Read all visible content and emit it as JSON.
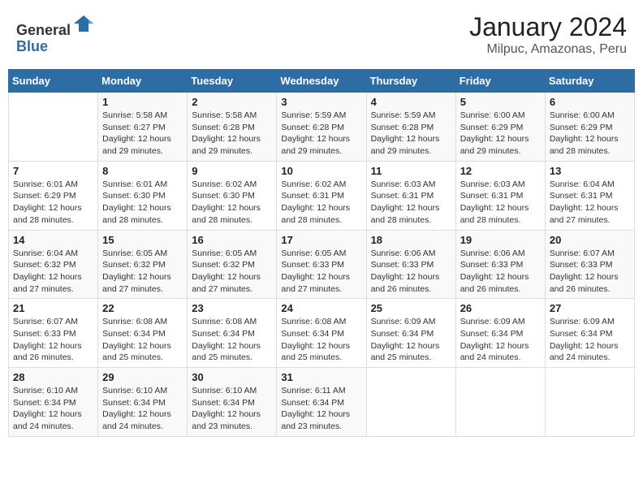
{
  "header": {
    "logo_general": "General",
    "logo_blue": "Blue",
    "title": "January 2024",
    "subtitle": "Milpuc, Amazonas, Peru"
  },
  "calendar": {
    "days_of_week": [
      "Sunday",
      "Monday",
      "Tuesday",
      "Wednesday",
      "Thursday",
      "Friday",
      "Saturday"
    ],
    "weeks": [
      [
        {
          "day": "",
          "info": ""
        },
        {
          "day": "1",
          "info": "Sunrise: 5:58 AM\nSunset: 6:27 PM\nDaylight: 12 hours\nand 29 minutes."
        },
        {
          "day": "2",
          "info": "Sunrise: 5:58 AM\nSunset: 6:28 PM\nDaylight: 12 hours\nand 29 minutes."
        },
        {
          "day": "3",
          "info": "Sunrise: 5:59 AM\nSunset: 6:28 PM\nDaylight: 12 hours\nand 29 minutes."
        },
        {
          "day": "4",
          "info": "Sunrise: 5:59 AM\nSunset: 6:28 PM\nDaylight: 12 hours\nand 29 minutes."
        },
        {
          "day": "5",
          "info": "Sunrise: 6:00 AM\nSunset: 6:29 PM\nDaylight: 12 hours\nand 29 minutes."
        },
        {
          "day": "6",
          "info": "Sunrise: 6:00 AM\nSunset: 6:29 PM\nDaylight: 12 hours\nand 28 minutes."
        }
      ],
      [
        {
          "day": "7",
          "info": "Sunrise: 6:01 AM\nSunset: 6:29 PM\nDaylight: 12 hours\nand 28 minutes."
        },
        {
          "day": "8",
          "info": "Sunrise: 6:01 AM\nSunset: 6:30 PM\nDaylight: 12 hours\nand 28 minutes."
        },
        {
          "day": "9",
          "info": "Sunrise: 6:02 AM\nSunset: 6:30 PM\nDaylight: 12 hours\nand 28 minutes."
        },
        {
          "day": "10",
          "info": "Sunrise: 6:02 AM\nSunset: 6:31 PM\nDaylight: 12 hours\nand 28 minutes."
        },
        {
          "day": "11",
          "info": "Sunrise: 6:03 AM\nSunset: 6:31 PM\nDaylight: 12 hours\nand 28 minutes."
        },
        {
          "day": "12",
          "info": "Sunrise: 6:03 AM\nSunset: 6:31 PM\nDaylight: 12 hours\nand 28 minutes."
        },
        {
          "day": "13",
          "info": "Sunrise: 6:04 AM\nSunset: 6:31 PM\nDaylight: 12 hours\nand 27 minutes."
        }
      ],
      [
        {
          "day": "14",
          "info": "Sunrise: 6:04 AM\nSunset: 6:32 PM\nDaylight: 12 hours\nand 27 minutes."
        },
        {
          "day": "15",
          "info": "Sunrise: 6:05 AM\nSunset: 6:32 PM\nDaylight: 12 hours\nand 27 minutes."
        },
        {
          "day": "16",
          "info": "Sunrise: 6:05 AM\nSunset: 6:32 PM\nDaylight: 12 hours\nand 27 minutes."
        },
        {
          "day": "17",
          "info": "Sunrise: 6:05 AM\nSunset: 6:33 PM\nDaylight: 12 hours\nand 27 minutes."
        },
        {
          "day": "18",
          "info": "Sunrise: 6:06 AM\nSunset: 6:33 PM\nDaylight: 12 hours\nand 26 minutes."
        },
        {
          "day": "19",
          "info": "Sunrise: 6:06 AM\nSunset: 6:33 PM\nDaylight: 12 hours\nand 26 minutes."
        },
        {
          "day": "20",
          "info": "Sunrise: 6:07 AM\nSunset: 6:33 PM\nDaylight: 12 hours\nand 26 minutes."
        }
      ],
      [
        {
          "day": "21",
          "info": "Sunrise: 6:07 AM\nSunset: 6:33 PM\nDaylight: 12 hours\nand 26 minutes."
        },
        {
          "day": "22",
          "info": "Sunrise: 6:08 AM\nSunset: 6:34 PM\nDaylight: 12 hours\nand 25 minutes."
        },
        {
          "day": "23",
          "info": "Sunrise: 6:08 AM\nSunset: 6:34 PM\nDaylight: 12 hours\nand 25 minutes."
        },
        {
          "day": "24",
          "info": "Sunrise: 6:08 AM\nSunset: 6:34 PM\nDaylight: 12 hours\nand 25 minutes."
        },
        {
          "day": "25",
          "info": "Sunrise: 6:09 AM\nSunset: 6:34 PM\nDaylight: 12 hours\nand 25 minutes."
        },
        {
          "day": "26",
          "info": "Sunrise: 6:09 AM\nSunset: 6:34 PM\nDaylight: 12 hours\nand 24 minutes."
        },
        {
          "day": "27",
          "info": "Sunrise: 6:09 AM\nSunset: 6:34 PM\nDaylight: 12 hours\nand 24 minutes."
        }
      ],
      [
        {
          "day": "28",
          "info": "Sunrise: 6:10 AM\nSunset: 6:34 PM\nDaylight: 12 hours\nand 24 minutes."
        },
        {
          "day": "29",
          "info": "Sunrise: 6:10 AM\nSunset: 6:34 PM\nDaylight: 12 hours\nand 24 minutes."
        },
        {
          "day": "30",
          "info": "Sunrise: 6:10 AM\nSunset: 6:34 PM\nDaylight: 12 hours\nand 23 minutes."
        },
        {
          "day": "31",
          "info": "Sunrise: 6:11 AM\nSunset: 6:34 PM\nDaylight: 12 hours\nand 23 minutes."
        },
        {
          "day": "",
          "info": ""
        },
        {
          "day": "",
          "info": ""
        },
        {
          "day": "",
          "info": ""
        }
      ]
    ]
  }
}
